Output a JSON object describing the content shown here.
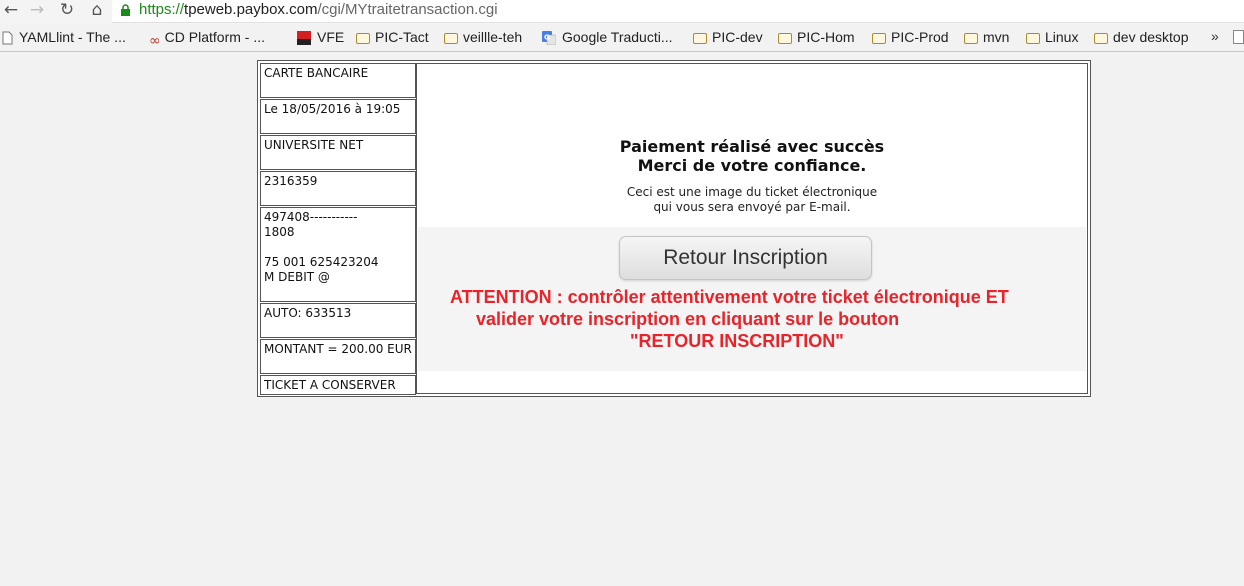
{
  "browser": {
    "url_proto": "https://",
    "url_host": "tpeweb.paybox.com",
    "url_path": "/cgi/MYtraitetransaction.cgi",
    "bookmarks": [
      {
        "label": "YAMLlint - The ...",
        "icon": "page-icon"
      },
      {
        "label": "CD Platform - ...",
        "icon": "infinity-icon"
      },
      {
        "label": "VFE",
        "icon": "vfe-logo-icon"
      },
      {
        "label": "PIC-Tact",
        "icon": "folder-icon"
      },
      {
        "label": "veillle-teh",
        "icon": "folder-icon"
      },
      {
        "label": "Google Traducti...",
        "icon": "google-translate-icon"
      },
      {
        "label": "PIC-dev",
        "icon": "folder-icon"
      },
      {
        "label": "PIC-Hom",
        "icon": "folder-icon"
      },
      {
        "label": "PIC-Prod",
        "icon": "folder-icon"
      },
      {
        "label": "mvn",
        "icon": "folder-icon"
      },
      {
        "label": "Linux",
        "icon": "folder-icon"
      },
      {
        "label": "dev desktop",
        "icon": "folder-icon"
      }
    ],
    "more_label": "»"
  },
  "ticket": {
    "card_type": "CARTE BANCAIRE",
    "date": "Le 18/05/2016 à 19:05",
    "merchant": "UNIVERSITE NET",
    "site_number": "2316359",
    "card_details": "497408-----------\n1808\n\n75 001 625423204\nM DEBIT @",
    "auth": "AUTO: 633513",
    "amount": "MONTANT = 200.00 EUR",
    "keep": "TICKET A CONSERVER"
  },
  "panel": {
    "success_line1": "Paiement réalisé avec succès",
    "success_line2": "Merci de votre confiance.",
    "info_line1": "Ceci est une image du ticket électronique",
    "info_line2": "qui vous sera envoyé par E-mail.",
    "return_button": "Retour Inscription",
    "attention_line1": "ATTENTION : contrôler attentivement votre ticket électronique ET",
    "attention_line2": "valider votre inscription en cliquant sur le bouton",
    "attention_line3": "\"RETOUR INSCRIPTION\""
  },
  "colors": {
    "attention": "#e8232a",
    "secure_url": "#1a8a1a"
  }
}
